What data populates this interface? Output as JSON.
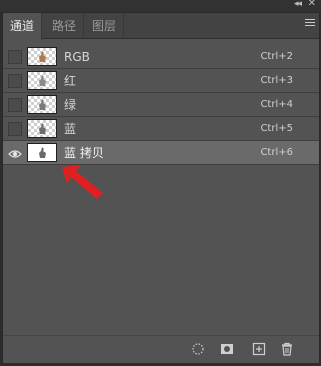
{
  "tabs": [
    {
      "label": "通道"
    },
    {
      "label": "路径"
    },
    {
      "label": "图层"
    }
  ],
  "titlebar": {
    "collapse_icon": "double-chevron-left-icon",
    "close_icon": "close-icon"
  },
  "channels": [
    {
      "name": "RGB",
      "shortcut": "Ctrl+2",
      "visible": false,
      "selected": false
    },
    {
      "name": "红",
      "shortcut": "Ctrl+3",
      "visible": false,
      "selected": false
    },
    {
      "name": "绿",
      "shortcut": "Ctrl+4",
      "visible": false,
      "selected": false
    },
    {
      "name": "蓝",
      "shortcut": "Ctrl+5",
      "visible": false,
      "selected": false
    },
    {
      "name": "蓝 拷贝",
      "shortcut": "Ctrl+6",
      "visible": true,
      "selected": true
    }
  ],
  "footer_icons": [
    "load-selection-icon",
    "save-selection-icon",
    "new-channel-icon",
    "delete-channel-icon"
  ],
  "colors": {
    "panel": "#535353",
    "selected_row": "#6a6a6a",
    "annotation_arrow": "#e02020"
  }
}
